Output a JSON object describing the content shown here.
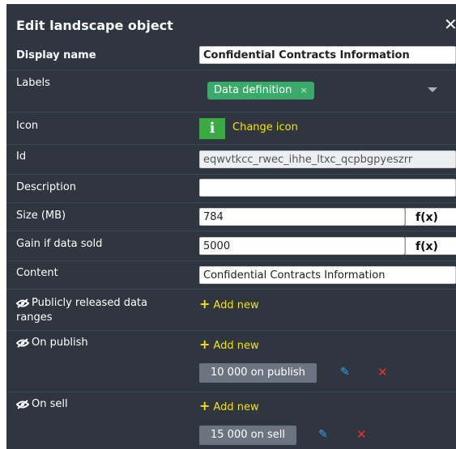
{
  "dialog": {
    "title": "Edit landscape object",
    "close_symbol": "✕"
  },
  "fields": {
    "display_name": {
      "label": "Display name",
      "value": "Confidential Contracts Information"
    },
    "labels": {
      "label": "Labels",
      "tag": "Data definition",
      "tag_remove": "×"
    },
    "icon": {
      "label": "Icon",
      "glyph": "i",
      "change_label": "Change icon"
    },
    "id": {
      "label": "Id",
      "value": "eqwvtkcc_rwec_ihhe_ltxc_qcpbgpyeszrr"
    },
    "description": {
      "label": "Description",
      "value": ""
    },
    "size": {
      "label": "Size (MB)",
      "value": "784",
      "fx": "f(x)"
    },
    "gain": {
      "label": "Gain if data sold",
      "value": "5000",
      "fx": "f(x)"
    },
    "content": {
      "label": "Content",
      "value": "Confidential Contracts Information"
    }
  },
  "sections": {
    "publicly_released": {
      "label": "Publicly released data ranges",
      "add_label": "Add new"
    },
    "on_publish": {
      "label": "On publish",
      "add_label": "Add new",
      "item": "10 000 on publish"
    },
    "on_sell": {
      "label": "On sell",
      "add_label": "Add new",
      "item": "15 000 on sell"
    }
  },
  "colors": {
    "panel_bg": "#2f3640",
    "accent_yellow": "#f4e300",
    "tag_green": "#3aaa6a",
    "edit_blue": "#3ba0ff",
    "delete_red": "#ff2a2a"
  },
  "icons": {
    "hidden": "eye-slash-icon",
    "edit": "pencil-icon",
    "delete": "x-icon",
    "dropdown": "caret-down-icon"
  }
}
